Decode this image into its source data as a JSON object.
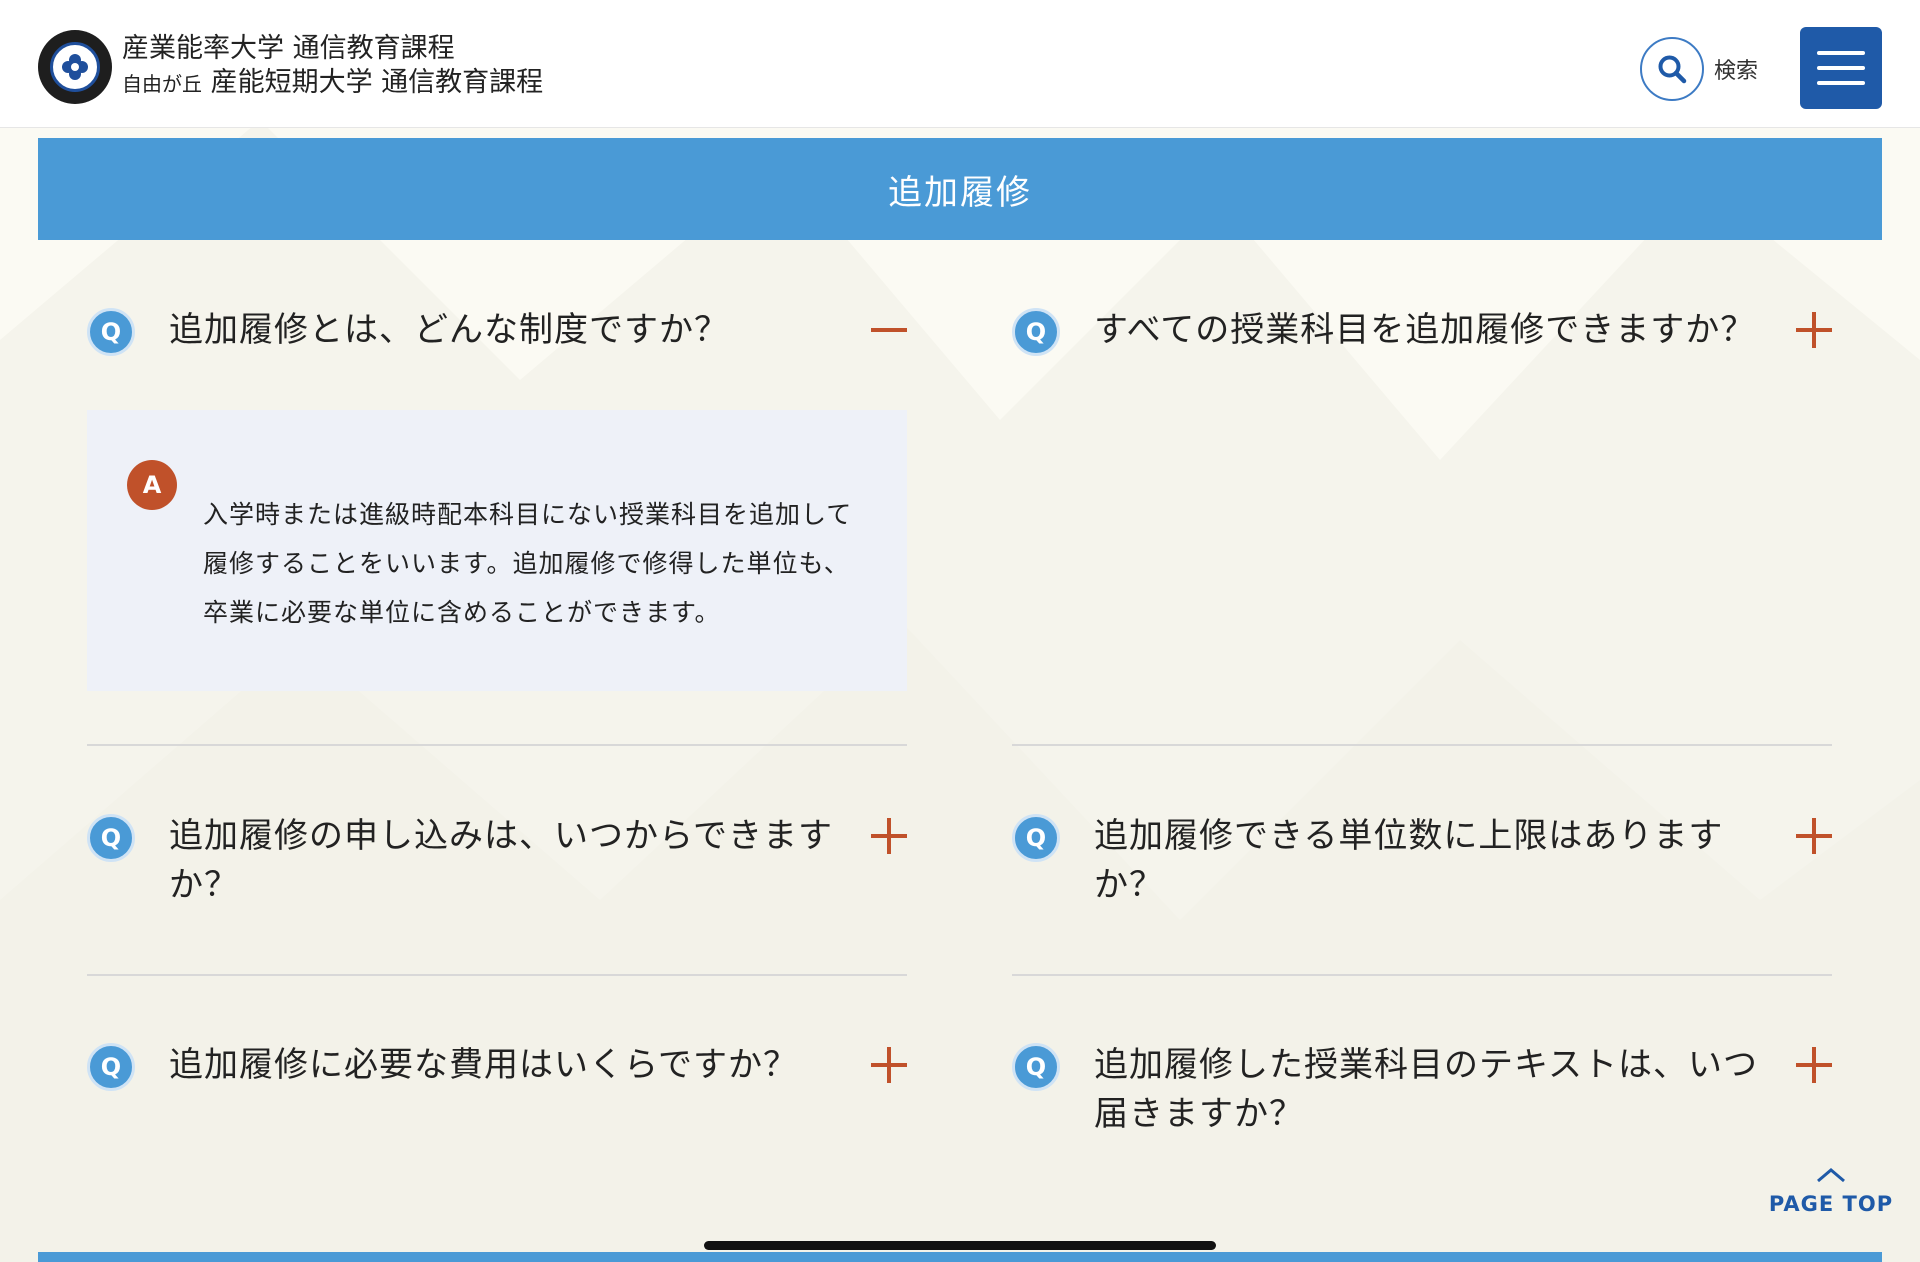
{
  "header": {
    "title_line1": "産業能率大学 通信教育課程",
    "title_line2_prefix": "自由が丘",
    "title_line2_main": "産能短期大学 通信教育課程",
    "search_label": "検索"
  },
  "section": {
    "title": "追加履修"
  },
  "faq": {
    "left": [
      {
        "q_badge": "Q",
        "question": "追加履修とは、どんな制度ですか？",
        "expanded": true,
        "a_badge": "A",
        "answer": "入学時または進級時配本科目にない授業科目を追加して履修することをいいます。追加履修で修得した単位も、卒業に必要な単位に含めることができます。"
      },
      {
        "q_badge": "Q",
        "question": "追加履修の申し込みは、いつからできますか？",
        "expanded": false
      },
      {
        "q_badge": "Q",
        "question": "追加履修に必要な費用はいくらですか？",
        "expanded": false
      }
    ],
    "right": [
      {
        "q_badge": "Q",
        "question": "すべての授業科目を追加履修できますか？",
        "expanded": false
      },
      {
        "q_badge": "Q",
        "question": "追加履修できる単位数に上限はありますか？",
        "expanded": false
      },
      {
        "q_badge": "Q",
        "question": "追加履修した授業科目のテキストは、いつ届きますか？",
        "expanded": false
      }
    ]
  },
  "page_top": {
    "label": "PAGE TOP"
  },
  "colors": {
    "accent_blue": "#4a9ad6",
    "dark_blue": "#1f5aa8",
    "accent_orange": "#c0512a",
    "answer_bg": "#eef1f8"
  },
  "icons": [
    "university-logo",
    "search-icon",
    "hamburger-menu-icon",
    "minus-icon",
    "plus-icon",
    "chevron-up-icon"
  ]
}
